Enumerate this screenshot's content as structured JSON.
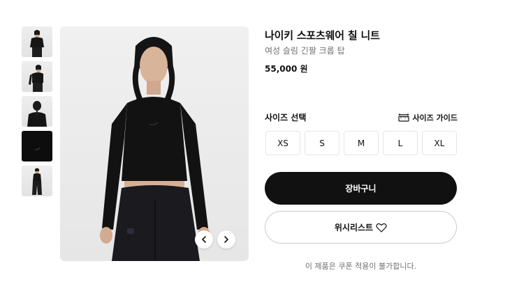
{
  "thumbnails": [
    {
      "icon": "model-front-thumbnail"
    },
    {
      "icon": "model-angle-thumbnail"
    },
    {
      "icon": "model-back-thumbnail"
    },
    {
      "icon": "fabric-detail-thumbnail"
    },
    {
      "icon": "model-full-thumbnail"
    }
  ],
  "gallery": {
    "prev_icon": "chevron-left-icon",
    "next_icon": "chevron-right-icon"
  },
  "product": {
    "title": "나이키 스포츠웨어 칠 니트",
    "subtitle": "여성 슬림 긴팔 크롭 탑",
    "price": "55,000 원"
  },
  "sizes": {
    "label": "사이즈 선택",
    "guide_label": "사이즈 가이드",
    "guide_icon": "ruler-icon",
    "options": [
      "XS",
      "S",
      "M",
      "L",
      "XL"
    ]
  },
  "actions": {
    "cart_label": "장바구니",
    "wishlist_label": "위시리스트",
    "wishlist_icon": "heart-icon"
  },
  "notes": {
    "coupon": "이 제품은 쿠폰 적용이 불가합니다."
  },
  "colors": {
    "primary": "#111111",
    "muted_text": "#707072",
    "border": "#e5e5e5",
    "background": "#ffffff"
  }
}
